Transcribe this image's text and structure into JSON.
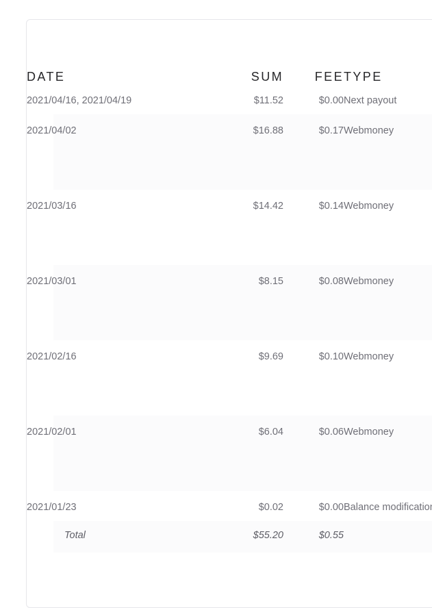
{
  "card": {
    "name": "payouts-history-card"
  },
  "table": {
    "columns": [
      {
        "key": "date",
        "label": "DATE",
        "align": "left"
      },
      {
        "key": "sum",
        "label": "SUM",
        "align": "right"
      },
      {
        "key": "fee",
        "label": "FEE",
        "align": "right"
      },
      {
        "key": "type",
        "label": "TYPE",
        "align": "left"
      }
    ],
    "rows": [
      {
        "date": "2021/04/16, 2021/04/19",
        "sum": "$11.52",
        "fee": "$0.00",
        "type": "Next payout",
        "shaded": false,
        "short": true
      },
      {
        "date": "2021/04/02",
        "sum": "$16.88",
        "fee": "$0.17",
        "type": "Webmoney",
        "shaded": true,
        "short": false
      },
      {
        "date": "2021/03/16",
        "sum": "$14.42",
        "fee": "$0.14",
        "type": "Webmoney",
        "shaded": false,
        "short": false
      },
      {
        "date": "2021/03/01",
        "sum": "$8.15",
        "fee": "$0.08",
        "type": "Webmoney",
        "shaded": true,
        "short": false
      },
      {
        "date": "2021/02/16",
        "sum": "$9.69",
        "fee": "$0.10",
        "type": "Webmoney",
        "shaded": false,
        "short": false
      },
      {
        "date": "2021/02/01",
        "sum": "$6.04",
        "fee": "$0.06",
        "type": "Webmoney",
        "shaded": true,
        "short": false
      },
      {
        "date": "2021/01/23",
        "sum": "$0.02",
        "fee": "$0.00",
        "type": "Balance modification",
        "shaded": false,
        "short": true
      }
    ],
    "total": {
      "label": "Total",
      "sum": "$55.20",
      "fee": "$0.55",
      "type": ""
    }
  },
  "colors": {
    "card_background": "#ffffff",
    "card_border": "#e6e6ea",
    "row_shade": "#fbfbfc",
    "header_text": "#262629",
    "body_text": "#6f6f77",
    "total_text": "#5e5e66"
  }
}
